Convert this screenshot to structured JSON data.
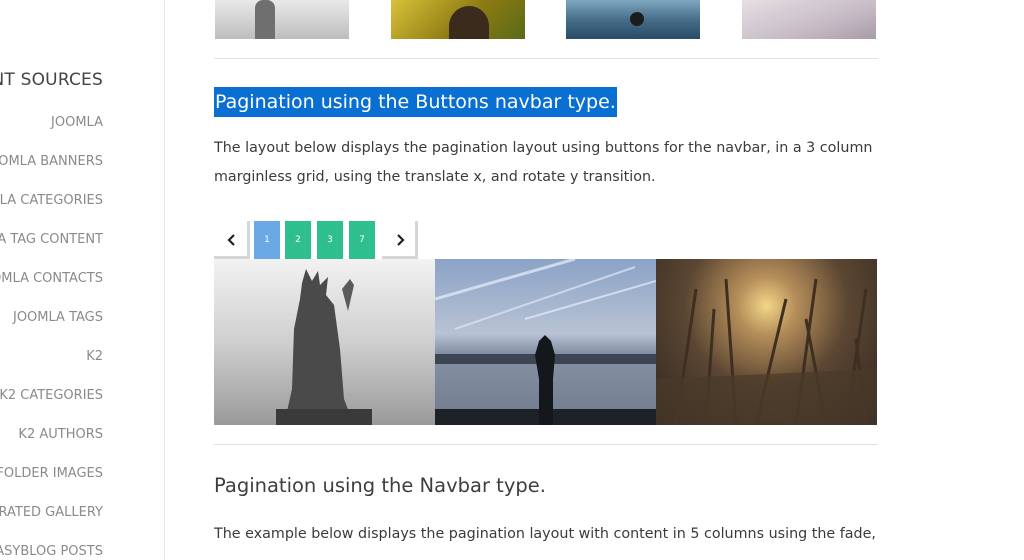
{
  "sidebar": {
    "title": "NT SOURCES",
    "items": [
      "JOOMLA",
      "OOMLA BANNERS",
      "MLA CATEGORIES",
      "A TAG CONTENT",
      "OMLA CONTACTS",
      "JOOMLA TAGS",
      "K2",
      "K2 CATEGORIES",
      "K2 AUTHORS",
      "FOLDER IMAGES",
      "URATED GALLERY",
      "ASYBLOG POSTS"
    ]
  },
  "section_buttons": {
    "heading": "Pagination using the Buttons navbar type.",
    "description": "The layout below displays the pagination layout using buttons for the navbar, in a 3 column marginless grid, using the translate x, and rotate y transition.",
    "pagination": {
      "prev_icon": "chevron-left-icon",
      "next_icon": "chevron-right-icon",
      "pages": [
        "1",
        "2",
        "3",
        "7"
      ],
      "active_page": "1"
    },
    "images": [
      "statue-of-liberty",
      "person-at-lake",
      "sunset-through-grass"
    ]
  },
  "section_navbar": {
    "heading": "Pagination using the Navbar type.",
    "description": "The example below displays the pagination layout with content in 5 columns using the fade,"
  },
  "colors": {
    "selection": "#0a6fd2",
    "active_page": "#6aa9e6",
    "page_button": "#2fbf8e"
  }
}
